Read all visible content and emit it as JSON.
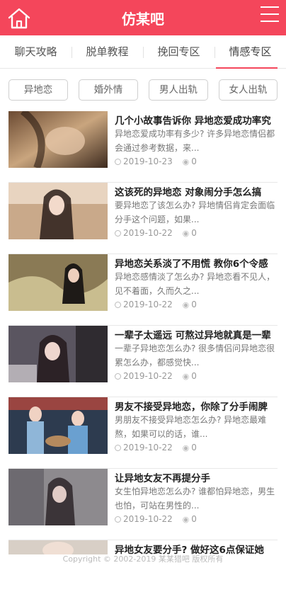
{
  "header": {
    "title": "仿某吧",
    "home_icon": "home-icon",
    "menu_icon": "hamburger-menu-icon",
    "color": "#f4465b"
  },
  "tabs": [
    {
      "label": "聊天攻略",
      "active": false
    },
    {
      "label": "脱单教程",
      "active": false
    },
    {
      "label": "挽回专区",
      "active": false
    },
    {
      "label": "情感专区",
      "active": true
    }
  ],
  "tags": [
    {
      "label": "异地恋"
    },
    {
      "label": "婚外情"
    },
    {
      "label": "男人出轨"
    },
    {
      "label": "女人出轨"
    }
  ],
  "articles": [
    {
      "title": "几个小故事告诉你 异地恋爱成功率究",
      "desc": "异地恋爱成功率有多少? 许多异地恋情侣都会通过参考数据，来...",
      "date": "2019-10-23",
      "views": "0"
    },
    {
      "title": "这该死的异地恋 对象闹分手怎么搞",
      "desc": "要异地恋了该怎么办? 异地情侣肯定会面临分手这个问题，如果...",
      "date": "2019-10-22",
      "views": "0"
    },
    {
      "title": "异地恋关系淡了不用慌 教你6个令感",
      "desc": "异地恋感情淡了怎么办? 异地恋看不见人，见不着面，久而久之...",
      "date": "2019-10-22",
      "views": "0"
    },
    {
      "title": "一辈子太遥远 可熬过异地就真是一辈",
      "desc": "一辈子异地恋怎么办? 很多情侣问异地恋很累怎么办，都感觉快...",
      "date": "2019-10-22",
      "views": "0"
    },
    {
      "title": "男友不接受异地恋，你除了分手闹脾",
      "desc": "男朋友不接受异地恋怎么办? 异地恋最难熬，如果可以的话，谁...",
      "date": "2019-10-22",
      "views": "0"
    },
    {
      "title": "让异地女友不再提分手",
      "desc": "女生怕异地恋怎么办? 谁都怕异地恋，男生也怕，可站在男性的...",
      "date": "2019-10-22",
      "views": "0"
    },
    {
      "title": "异地女友要分手? 做好这6点保证她",
      "desc": "",
      "date": "",
      "views": ""
    }
  ],
  "footer": {
    "copyright": "Copyright © 2002-2019 某某猎吧 版权所有"
  }
}
